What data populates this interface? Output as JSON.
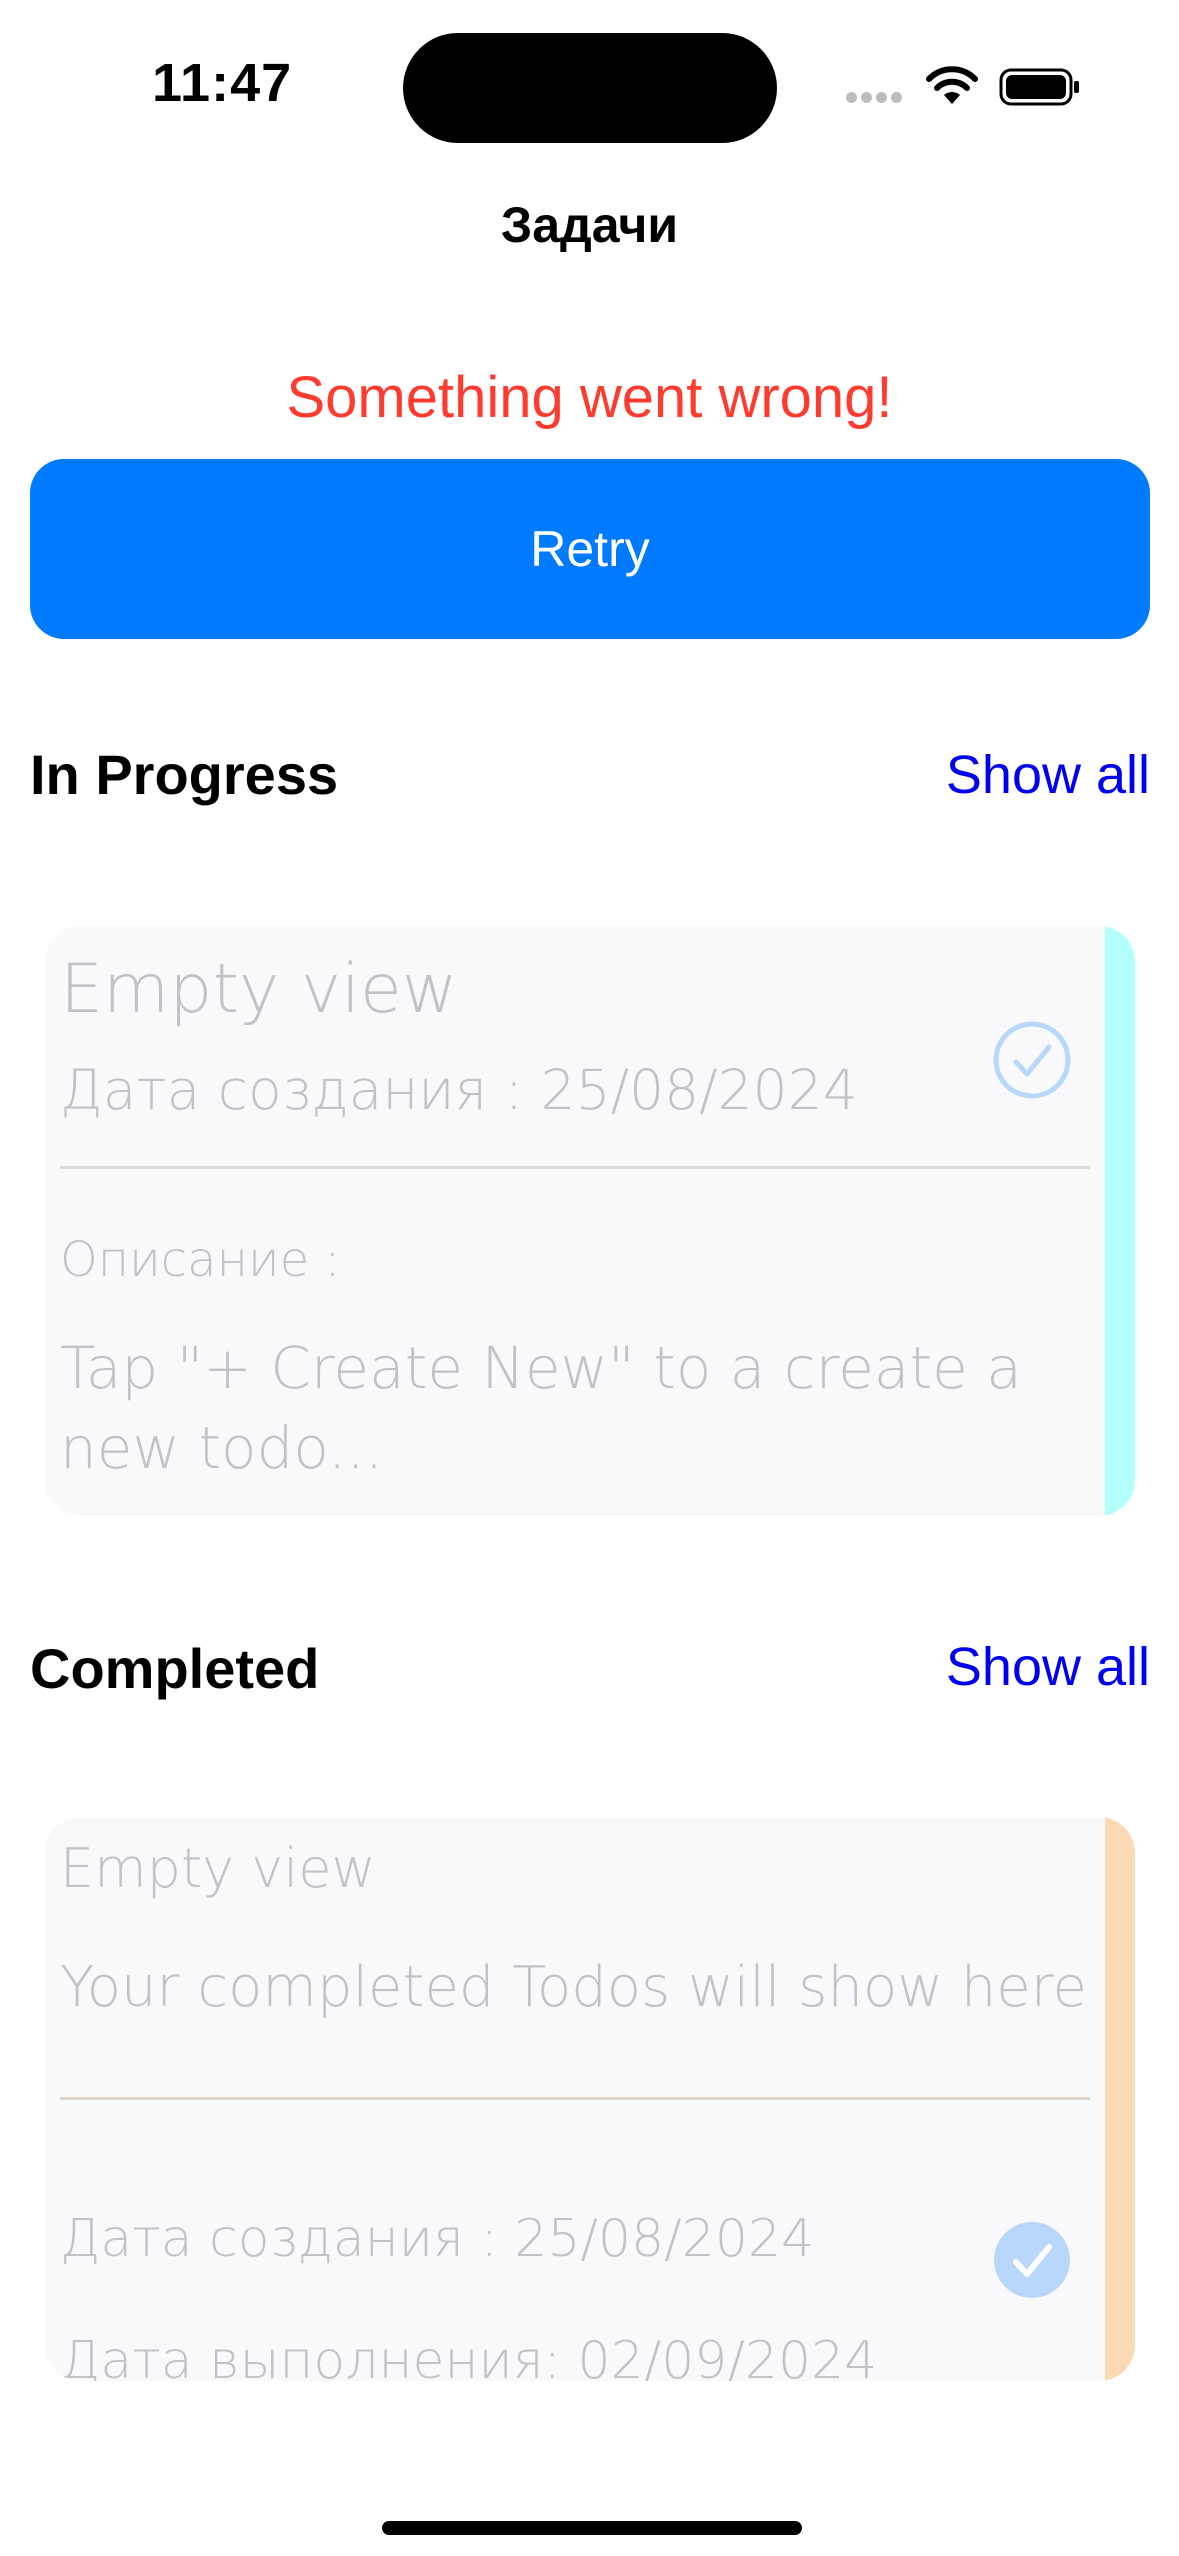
{
  "status_bar": {
    "time": "11:47"
  },
  "nav": {
    "title": "Задачи"
  },
  "error": {
    "message": "Something went wrong!",
    "retry_label": "Retry",
    "message_color": "#ff3b30",
    "button_color": "#007aff"
  },
  "in_progress": {
    "title": "In Progress",
    "show_all": "Show all",
    "card": {
      "title": "Empty view",
      "created": "Дата создания : 25/08/2024",
      "description_label": "Описание :",
      "description_line1": "Tap \"+ Create New\" to a create a",
      "description_line2": "new todo...",
      "accent_color": "#b3fffb",
      "icon": "check-circle-outline-icon"
    }
  },
  "completed": {
    "title": "Completed",
    "show_all": "Show all",
    "card": {
      "title": "Empty view",
      "subtitle": "Your completed Todos will show here",
      "created": "Дата создания : 25/08/2024",
      "done": "Дата выполнения: 02/09/2024",
      "accent_color": "#fcd9b5",
      "icon": "check-circle-filled-icon"
    }
  }
}
